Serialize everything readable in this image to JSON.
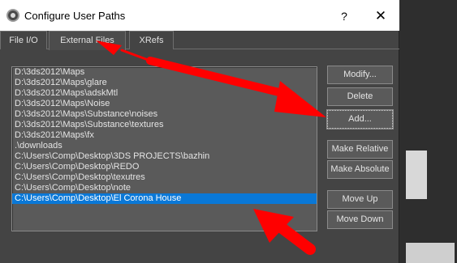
{
  "window": {
    "title": "Configure User Paths",
    "help_label": "?",
    "close_label": "✕"
  },
  "tabs": [
    {
      "label": "File I/O",
      "active": false
    },
    {
      "label": "External Files",
      "active": true
    },
    {
      "label": "XRefs",
      "active": false
    }
  ],
  "paths": [
    "D:\\3ds2012\\Maps",
    "D:\\3ds2012\\Maps\\glare",
    "D:\\3ds2012\\Maps\\adskMtl",
    "D:\\3ds2012\\Maps\\Noise",
    "D:\\3ds2012\\Maps\\Substance\\noises",
    "D:\\3ds2012\\Maps\\Substance\\textures",
    "D:\\3ds2012\\Maps\\fx",
    ".\\downloads",
    "C:\\Users\\Comp\\Desktop\\3DS PROJECTS\\bazhin",
    "C:\\Users\\Comp\\Desktop\\REDO",
    "C:\\Users\\Comp\\Desktop\\texutres",
    "C:\\Users\\Comp\\Desktop\\note",
    "C:\\Users\\Comp\\Desktop\\El Corona House"
  ],
  "selected_path": "C:\\Users\\Comp\\Desktop\\El Corona House",
  "buttons": {
    "modify": "Modify...",
    "delete": "Delete",
    "add": "Add...",
    "make_relative": "Make Relative",
    "make_absolute": "Make Absolute",
    "move_up": "Move Up",
    "move_down": "Move Down"
  },
  "annotation_color": "#ff0000"
}
